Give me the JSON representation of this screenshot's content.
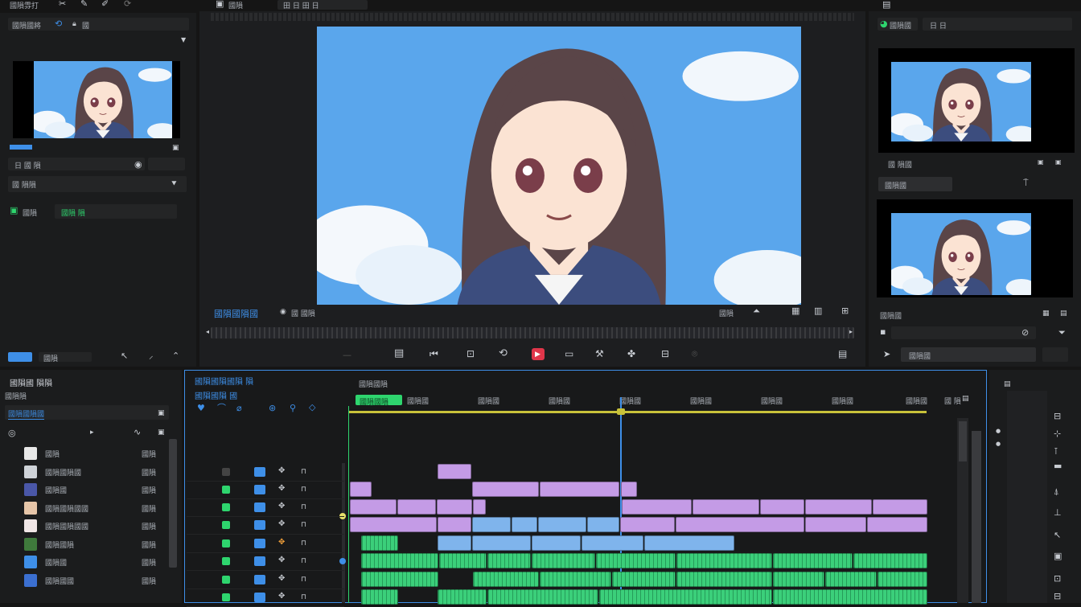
{
  "menu": {
    "left_label": "國隕雰打",
    "center_label": "國隕",
    "center_field": "田 日 田 日"
  },
  "left_panel": {
    "search_label": "國隕國將",
    "search_value": "國",
    "toolbar_label": "國隕",
    "row1_label": "日 國 隕",
    "section_label": "國 隕隕",
    "green_label": "國隕",
    "green_value": "國隕 隕"
  },
  "viewer": {
    "caption": "國隕國隕國",
    "timecode": "國 國隕",
    "right_label": "國隕"
  },
  "right_panel": {
    "tab_label": "國隕國",
    "field_label": "日 日",
    "row_label": "國 隕國",
    "field2": "國隕國",
    "caption": "國隕國",
    "bottom_label": "國隕國"
  },
  "bottom_left": {
    "title": "國隕國 隕隕",
    "subtitle": "國隕隕",
    "search_value": "國隕國隕國",
    "layers": [
      {
        "name": "國隕",
        "val": "國隕"
      },
      {
        "name": "國隕國隕國",
        "val": "國隕"
      },
      {
        "name": "國隕國",
        "val": "國隕"
      },
      {
        "name": "國隕國隕國國",
        "val": "國隕"
      },
      {
        "name": "國隕國隕國國",
        "val": "國隕"
      },
      {
        "name": "國隕國隕",
        "val": "國隕"
      },
      {
        "name": "國隕國",
        "val": "國隕"
      },
      {
        "name": "國隕國國",
        "val": "國隕"
      }
    ]
  },
  "timeline": {
    "title_line1": "國隕國隕國隕 隕",
    "title_line2": "國隕國隕 國",
    "header_label": "國隕國隕",
    "active_marker": "國隕國隕",
    "ruler_labels": [
      "國隕國",
      "國隕國",
      "國隕國",
      "國隕國",
      "國隕國",
      "國隕國",
      "國隕國",
      "國隕國",
      "國隕國"
    ],
    "right_readout": "國 隕"
  },
  "colors": {
    "accent_blue": "#3e8fe8",
    "accent_green": "#2ed56e",
    "clip_purple": "#c49be6",
    "clip_blue": "#7fb4ec",
    "clip_green": "#3bcf7a",
    "record_red": "#e0364a"
  }
}
